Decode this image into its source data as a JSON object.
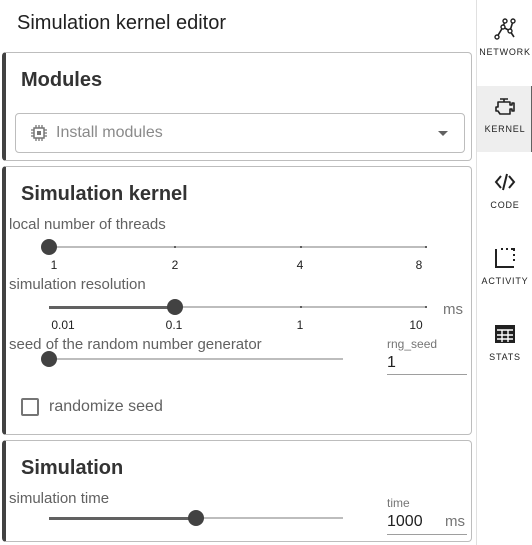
{
  "page_title": "Simulation kernel editor",
  "modules": {
    "title": "Modules",
    "select_placeholder": "Install modules"
  },
  "kernel": {
    "title": "Simulation kernel",
    "threads": {
      "label": "local number of threads",
      "ticks": [
        "1",
        "2",
        "4",
        "8"
      ],
      "value": "1"
    },
    "resolution": {
      "label": "simulation resolution",
      "ticks": [
        "0.01",
        "0.1",
        "1",
        "10"
      ],
      "value": "0.1",
      "unit": "ms"
    },
    "seed": {
      "label": "seed of the random number generator",
      "field_label": "rng_seed",
      "value": "1"
    },
    "randomize": {
      "label": "randomize seed",
      "checked": false
    }
  },
  "simulation": {
    "title": "Simulation",
    "time": {
      "label": "simulation time",
      "field_label": "time",
      "value": "1000",
      "unit": "ms",
      "fraction": 0.5
    }
  },
  "rail": {
    "items": [
      {
        "label": "NETWORK",
        "icon": "network-icon",
        "active": false
      },
      {
        "label": "KERNEL",
        "icon": "engine-icon",
        "active": true
      },
      {
        "label": "CODE",
        "icon": "code-icon",
        "active": false
      },
      {
        "label": "ACTIVITY",
        "icon": "activity-icon",
        "active": false
      },
      {
        "label": "STATS",
        "icon": "table-icon",
        "active": false
      }
    ]
  }
}
